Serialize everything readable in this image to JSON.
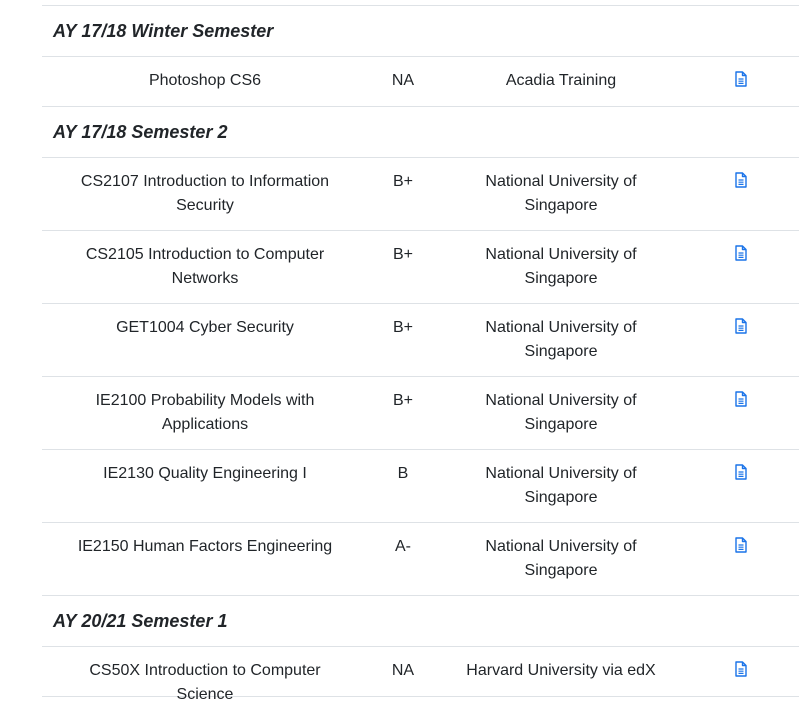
{
  "colors": {
    "text": "#212529",
    "border": "#dee2e6",
    "icon": "#1a73e8"
  },
  "icons": {
    "certificate": "file-document-icon"
  },
  "semesters": [
    {
      "title": "AY 17/18 Winter Semester",
      "courses": [
        {
          "name": "Photoshop CS6",
          "grade": "NA",
          "institution": "Acadia Training"
        }
      ]
    },
    {
      "title": "AY 17/18 Semester 2",
      "courses": [
        {
          "name": "CS2107 Introduction to Information Security",
          "grade": "B+",
          "institution": "National University of Singapore"
        },
        {
          "name": "CS2105 Introduction to Computer Networks",
          "grade": "B+",
          "institution": "National University of Singapore"
        },
        {
          "name": "GET1004 Cyber Security",
          "grade": "B+",
          "institution": "National University of Singapore"
        },
        {
          "name": "IE2100 Probability Models with Applications",
          "grade": "B+",
          "institution": "National University of Singapore"
        },
        {
          "name": "IE2130 Quality Engineering I",
          "grade": "B",
          "institution": "National University of Singapore"
        },
        {
          "name": "IE2150 Human Factors Engineering",
          "grade": "A-",
          "institution": "National University of Singapore"
        }
      ]
    },
    {
      "title": "AY 20/21 Semester 1",
      "courses": [
        {
          "name": "CS50X Introduction to Computer Science",
          "grade": "NA",
          "institution": "Harvard University via edX"
        }
      ]
    }
  ]
}
